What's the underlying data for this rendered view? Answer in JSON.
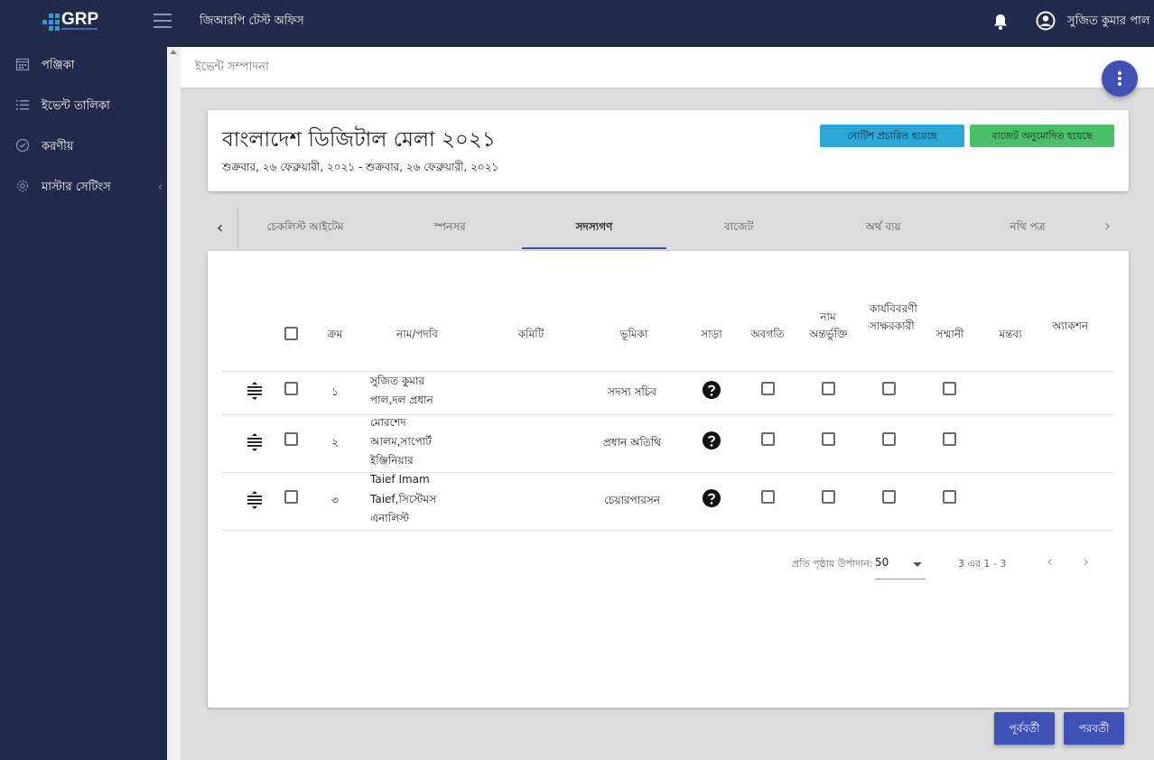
{
  "app": {
    "logo_text": "GRP",
    "office_name": "জিআরপি টেস্ট অফিস",
    "user_name": "সুজিত কুমার পাল"
  },
  "sidebar": {
    "items": [
      {
        "label": "পঞ্জিকা",
        "icon": "calendar-icon"
      },
      {
        "label": "ইভেন্ট তালিকা",
        "icon": "list-icon"
      },
      {
        "label": "করণীয়",
        "icon": "check-circle-icon"
      },
      {
        "label": "মাস্টার সেটিংস",
        "icon": "gear-icon"
      }
    ]
  },
  "breadcrumb": "ইভেন্ট সম্পাদনা",
  "event": {
    "title": "বাংলাদেশ ডিজিটাল মেলা ২০২১",
    "date_range": "শুক্রবার, ২৬ ফেব্রুয়ারী, ২০২১ - শুক্রবার, ২৬ ফেব্রুয়ারী, ২০২১",
    "badge_notice": "নোটিশ প্রচারিত হয়েছে",
    "badge_budget": "বাজেট অনুমোদিত হয়েছে"
  },
  "tabs": [
    {
      "label": "চেকলিস্ট আইটেম",
      "active": false
    },
    {
      "label": "স্পনসর",
      "active": false
    },
    {
      "label": "সদস্যগণ",
      "active": true
    },
    {
      "label": "বাজেট",
      "active": false
    },
    {
      "label": "অর্থ ব্যয়",
      "active": false
    },
    {
      "label": "নথি পত্র",
      "active": false
    }
  ],
  "table": {
    "headers": {
      "serial": "ক্রম",
      "name": "নাম/পদবি",
      "committee": "কমিটি",
      "role": "ভূমিকা",
      "response": "সাড়া",
      "informed": "অবগতি",
      "name_included": "নাম অন্তর্ভুক্তি",
      "minutes_signer": "কার্যবিবরণী সাক্ষরকারী",
      "honorarium": "সম্মানী",
      "remarks": "মন্তব্য",
      "action": "অ্যাকশন"
    },
    "rows": [
      {
        "serial": "১",
        "name_line1": "সুজিত কুমার",
        "name_line2": "পাল,দল প্রধান",
        "name_line3": "",
        "role": "সদস্য সচিব"
      },
      {
        "serial": "২",
        "name_line1": "মোরশেদ",
        "name_line2": "আলম,সাপোর্ট",
        "name_line3": "ইঞ্জিনিয়ার",
        "role": "প্রধান অতিথি"
      },
      {
        "serial": "৩",
        "name_line1": "Taief Imam",
        "name_line2": "Taief,সিস্টেমস",
        "name_line3": "এনালিস্ট",
        "role": "চেয়ারপারসন"
      }
    ]
  },
  "pagination": {
    "per_page_label": "প্রতি পৃষ্ঠায় উপাদান:",
    "per_page_value": "50",
    "range_label": "3 এর 1 - 3"
  },
  "buttons": {
    "previous": "পূর্ববর্তী",
    "next": "পরবর্তী"
  },
  "colors": {
    "navy": "#222a4b",
    "accent": "#3f51b5",
    "badge_blue": "#2aa8d8",
    "badge_green": "#4cbf6a"
  }
}
